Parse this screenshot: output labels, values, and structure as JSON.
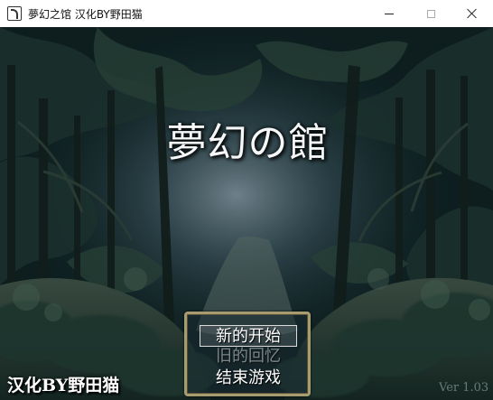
{
  "window": {
    "title": "夢幻之馆 汉化BY野田猫",
    "icon": "app-icon"
  },
  "game": {
    "title": "夢幻の館",
    "credit": "汉化BY野田猫",
    "version": "Ver 1.03"
  },
  "menu": {
    "items": [
      {
        "label": "新的开始",
        "state": "selected"
      },
      {
        "label": "旧的回忆",
        "state": "disabled"
      },
      {
        "label": "结束游戏",
        "state": "enabled"
      }
    ]
  },
  "colors": {
    "menu_border": "#a79b70",
    "menu_text": "#ffffff",
    "disabled_text": "#aeb5ba",
    "forest_dark": "#0d1c1f"
  }
}
